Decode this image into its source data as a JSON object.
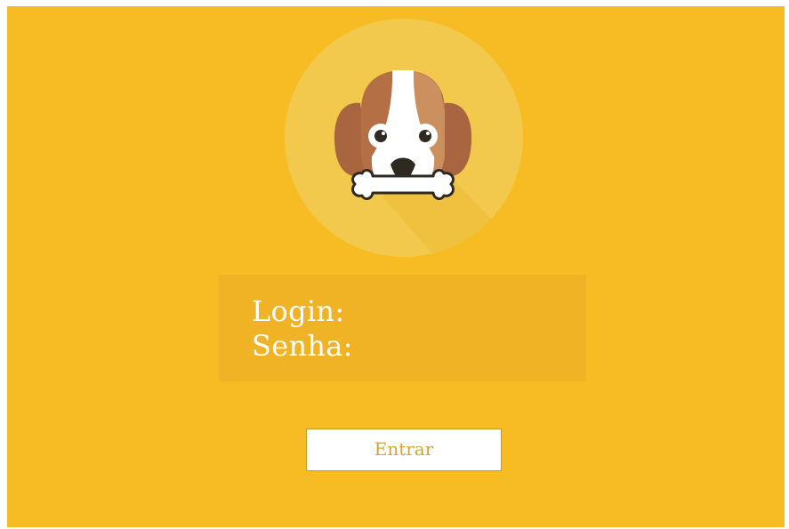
{
  "login_form": {
    "login_label": "Login:",
    "login_value": "",
    "password_label": "Senha:",
    "password_value": "",
    "submit_label": "Entrar"
  },
  "icons": {
    "avatar": "dog-with-bone-icon"
  },
  "colors": {
    "background": "#f7bb24",
    "panel": "#f0b325",
    "avatar_circle": "#f2c94c",
    "button_text": "#d2a431",
    "dog_brown": "#b46f45",
    "dog_tan": "#d7a26c"
  }
}
